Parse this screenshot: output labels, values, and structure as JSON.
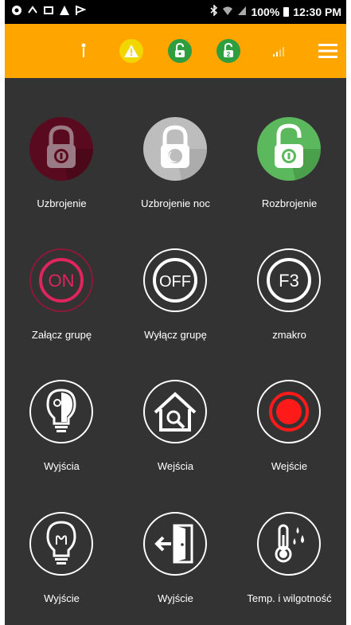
{
  "status_bar": {
    "battery": "100%",
    "time": "12:30 PM"
  },
  "app_bar": {
    "icons": [
      "antenna-icon",
      "warning-icon",
      "unlocked-badge-icon",
      "unlocked-2-badge-icon",
      "signal-icon",
      "menu-icon"
    ],
    "colors": {
      "bar": "#ffa500",
      "warning": "#f2d600",
      "green": "#2e9e3e"
    }
  },
  "tiles": [
    {
      "label": "Uzbrojenie",
      "icon": "padlock-locked-icon"
    },
    {
      "label": "Uzbrojenie noc",
      "icon": "padlock-night-icon"
    },
    {
      "label": "Rozbrojenie",
      "icon": "padlock-open-icon"
    },
    {
      "label": "Załącz grupę",
      "icon": "on-icon",
      "text": "ON"
    },
    {
      "label": "Wyłącz grupę",
      "icon": "off-icon",
      "text": "OFF"
    },
    {
      "label": "zmakro",
      "icon": "f3-icon",
      "text": "F3"
    },
    {
      "label": "Wyjścia",
      "icon": "bulb-half-icon"
    },
    {
      "label": "Wejścia",
      "icon": "house-search-icon"
    },
    {
      "label": "Wejście",
      "icon": "record-icon"
    },
    {
      "label": "Wyjście",
      "icon": "bulb-icon"
    },
    {
      "label": "Wyjście",
      "icon": "door-exit-icon"
    },
    {
      "label": "Temp. i wilgotność",
      "icon": "thermometer-drops-icon"
    }
  ]
}
